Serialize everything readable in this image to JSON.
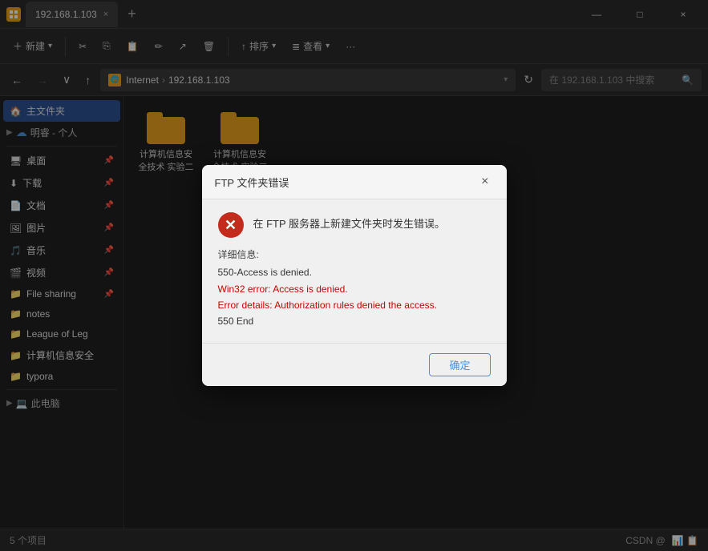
{
  "titleBar": {
    "icon": "🗂",
    "tab": {
      "label": "192.168.1.103",
      "close": "×"
    },
    "newTab": "+",
    "minimize": "—",
    "maximize": "□",
    "close": "×"
  },
  "toolbar": {
    "new": "新建",
    "cut": "",
    "copy": "",
    "paste": "",
    "rename": "",
    "delete": "",
    "sort": "排序",
    "sort_icon": "↑",
    "view": "查看",
    "view_icon": "≣",
    "more": "···"
  },
  "addressBar": {
    "back": "←",
    "forward": "→",
    "down": "∨",
    "up": "↑",
    "breadcrumb": [
      "Internet",
      "192.168.1.103"
    ],
    "refresh": "↻",
    "searchPlaceholder": "在 192.168.1.103 中搜索"
  },
  "sidebar": {
    "mainFolder": "主文件夹",
    "cloudItem": "明睿 - 个人",
    "items": [
      {
        "label": "桌面",
        "icon": "desktop",
        "pin": true
      },
      {
        "label": "下载",
        "icon": "download",
        "pin": true
      },
      {
        "label": "文档",
        "icon": "doc",
        "pin": true
      },
      {
        "label": "图片",
        "icon": "picture",
        "pin": true
      },
      {
        "label": "音乐",
        "icon": "music",
        "pin": true
      },
      {
        "label": "视频",
        "icon": "video",
        "pin": true
      },
      {
        "label": "File sharing",
        "icon": "folder",
        "pin": true
      },
      {
        "label": "notes",
        "icon": "folder",
        "pin": false
      },
      {
        "label": "League of Leg",
        "icon": "folder",
        "pin": false
      },
      {
        "label": "计算机信息安全",
        "icon": "folder",
        "pin": false
      },
      {
        "label": "typora",
        "icon": "folder",
        "pin": false
      }
    ],
    "thisPC": "此电脑"
  },
  "fileArea": {
    "folders": [
      {
        "label": "计算机信息安全技术 实验二"
      },
      {
        "label": "计算机信息安全技术 实验三"
      }
    ]
  },
  "modal": {
    "title": "FTP 文件夹错误",
    "mainText": "在 FTP 服务器上新建文件夹时发生错误。",
    "detailLabel": "详细信息:",
    "line1": "550-Access is denied.",
    "line2": " Win32 error:  Access is denied.",
    "line3": " Error details: Authorization rules denied the access.",
    "line4": "550 End",
    "okBtn": "确定"
  },
  "statusBar": {
    "itemCount": "5 个项目",
    "rightText": "CSDN @"
  }
}
